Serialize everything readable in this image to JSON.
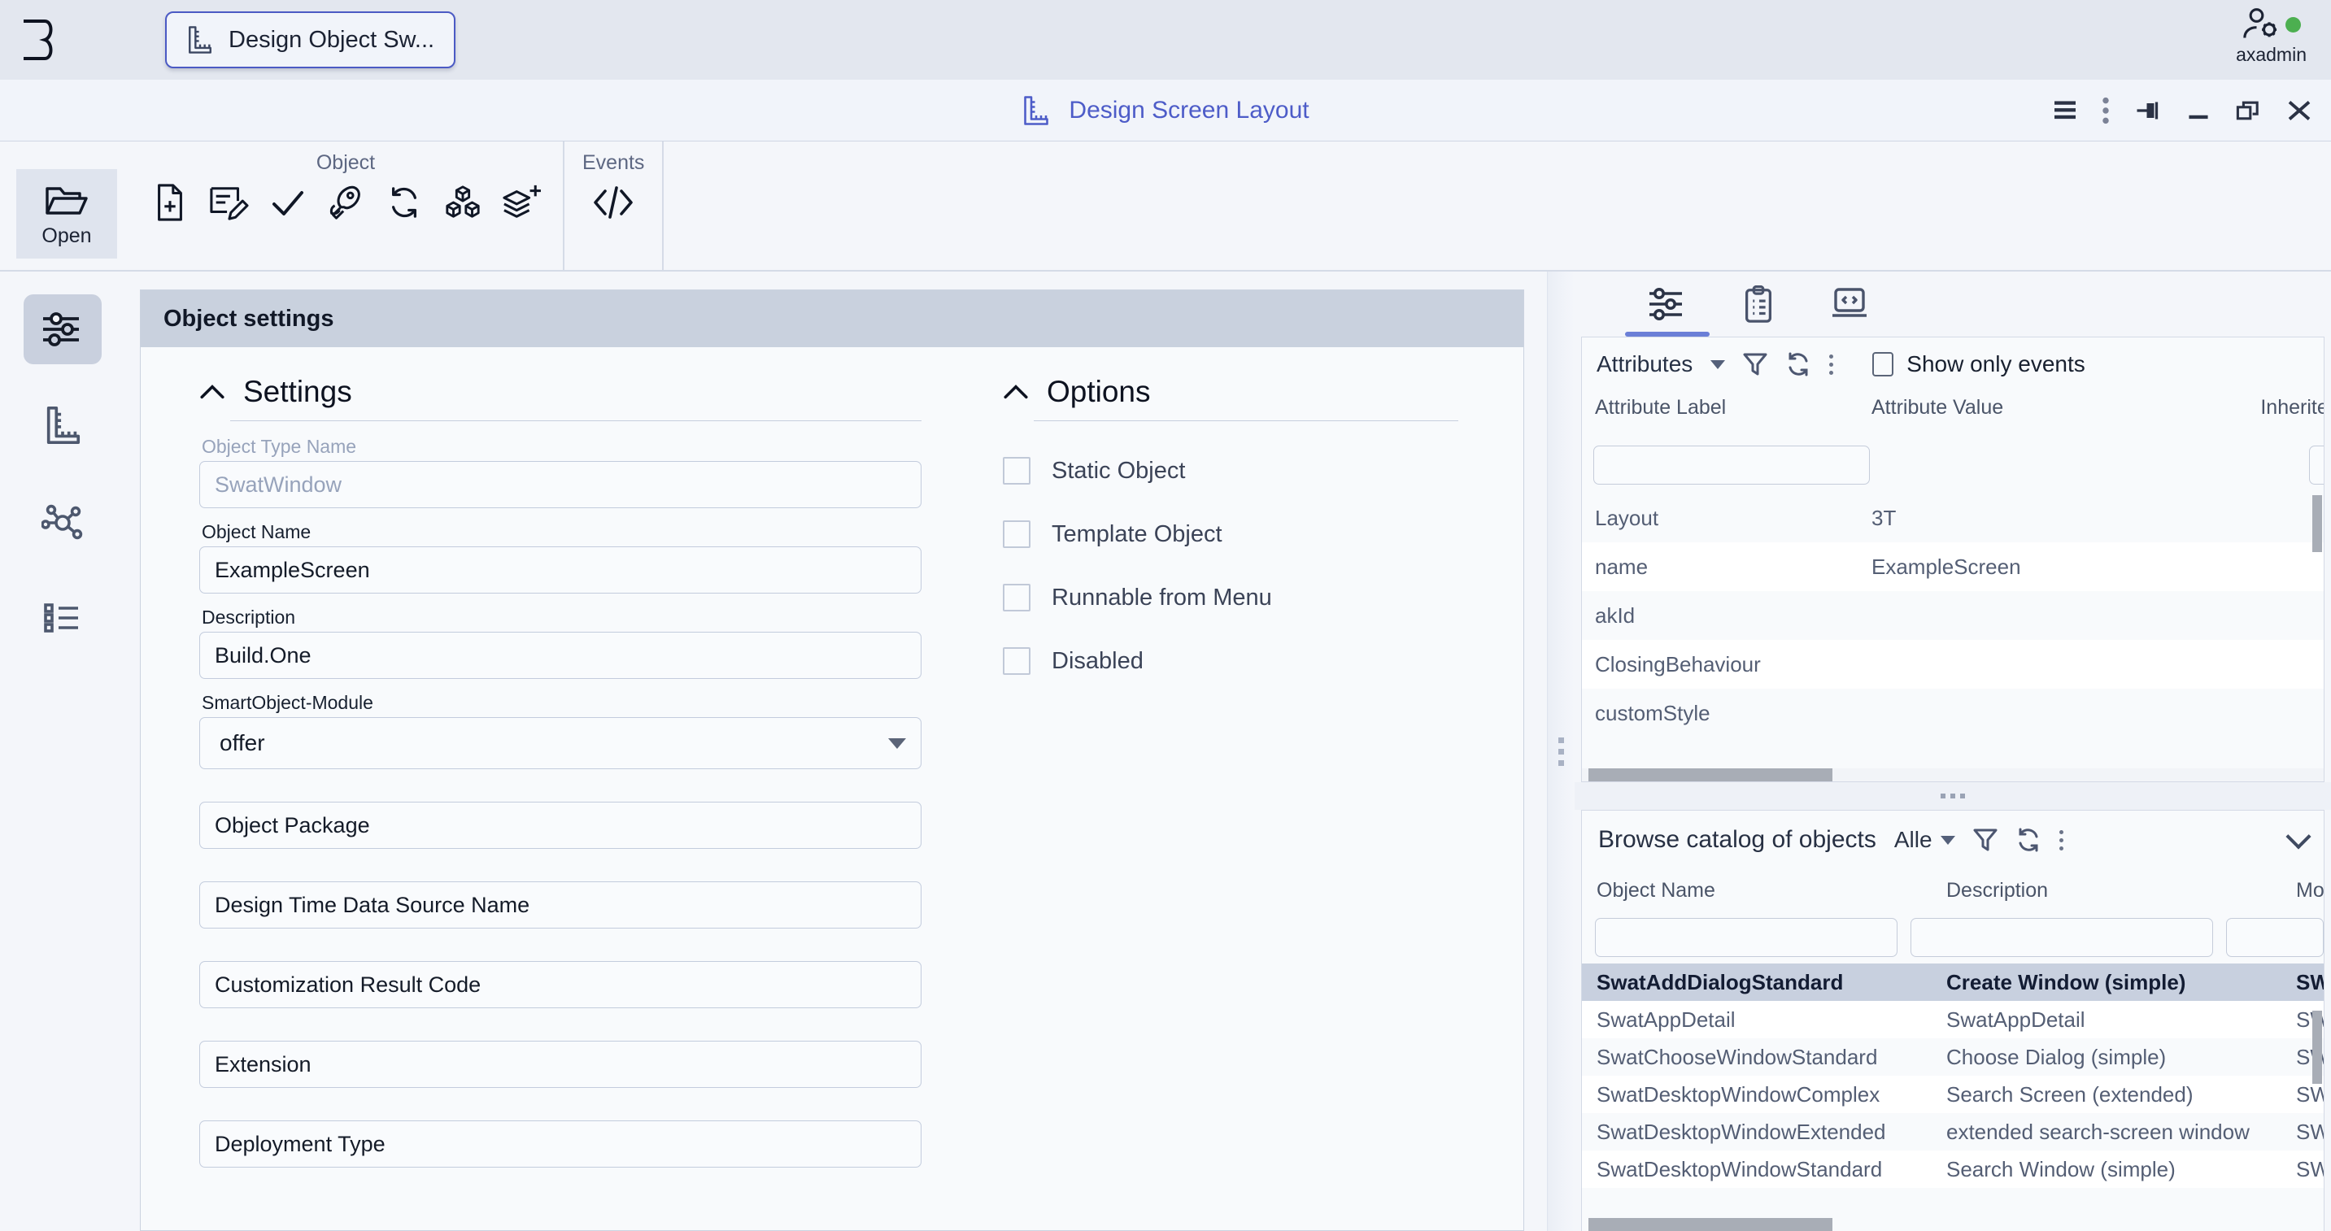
{
  "appbar": {
    "logo_icon": "logo-b-mark",
    "tab": {
      "icon": "ruler-icon",
      "label": "Design Object Sw..."
    },
    "user": {
      "icon": "user-gear-icon",
      "name": "axadmin",
      "status_color": "#4caf50"
    }
  },
  "window": {
    "icon": "ruler-icon",
    "title": "Design Screen Layout",
    "controls": [
      {
        "name": "menu-icon"
      },
      {
        "name": "kebab-menu-icon"
      },
      {
        "name": "pin-icon"
      },
      {
        "name": "minimize-icon"
      },
      {
        "name": "restore-icon"
      },
      {
        "name": "close-icon"
      }
    ]
  },
  "ribbon": {
    "open_button": {
      "icon": "folder-open-icon",
      "label": "Open"
    },
    "groups": [
      {
        "title": "Object",
        "icons": [
          "new-file-icon",
          "edit-document-icon",
          "check-icon",
          "rocket-icon",
          "refresh-icon",
          "cubes-icon",
          "layers-add-icon"
        ]
      },
      {
        "title": "Events",
        "icons": [
          "code-icon"
        ]
      }
    ]
  },
  "rail": {
    "items": [
      {
        "name": "sliders-icon",
        "active": true
      },
      {
        "name": "ruler-icon",
        "active": false
      },
      {
        "name": "network-icon",
        "active": false
      },
      {
        "name": "list-icon",
        "active": false
      }
    ]
  },
  "main": {
    "card_title": "Object settings",
    "settings": {
      "title": "Settings",
      "collapse_icon": "chevron-up-icon",
      "fields": [
        {
          "label": "Object Type Name",
          "value": "SwatWindow",
          "muted": true,
          "type": "text"
        },
        {
          "label": "Object Name",
          "value": "ExampleScreen",
          "muted": false,
          "type": "text"
        },
        {
          "label": "Description",
          "value": "Build.One",
          "muted": false,
          "type": "text"
        },
        {
          "label": "SmartObject-Module",
          "value": "offer",
          "muted": false,
          "type": "select"
        }
      ],
      "placeholder_fields": [
        "Object Package",
        "Design Time Data Source Name",
        "Customization Result Code",
        "Extension",
        "Deployment Type"
      ]
    },
    "options": {
      "title": "Options",
      "collapse_icon": "chevron-up-icon",
      "checkboxes": [
        {
          "label": "Static Object",
          "checked": false
        },
        {
          "label": "Template Object",
          "checked": false
        },
        {
          "label": "Runnable from Menu",
          "checked": false
        },
        {
          "label": "Disabled",
          "checked": false
        }
      ]
    }
  },
  "rightpane": {
    "tabs": [
      {
        "name": "sliders-icon",
        "active": true
      },
      {
        "name": "clipboard-list-icon",
        "active": false
      },
      {
        "name": "code-screen-icon",
        "active": false
      }
    ],
    "attributes": {
      "toolbar": {
        "label": "Attributes",
        "dropdown_icon": "caret-down-icon",
        "filter_icon": "filter-icon",
        "refresh_icon": "refresh-icon",
        "kebab_icon": "kebab-menu-icon",
        "checkbox_label": "Show only events",
        "checkbox_checked": false
      },
      "columns": [
        "Attribute Label",
        "Attribute Value",
        "Inherited"
      ],
      "rows": [
        {
          "label": "Layout",
          "value": "3T",
          "inherited": ""
        },
        {
          "label": "name",
          "value": "ExampleScreen",
          "inherited": ""
        },
        {
          "label": "akId",
          "value": "",
          "inherited": ""
        },
        {
          "label": "ClosingBehaviour",
          "value": "",
          "inherited": ""
        },
        {
          "label": "customStyle",
          "value": "",
          "inherited": ""
        }
      ]
    },
    "catalog": {
      "title": "Browse catalog of objects",
      "select_value": "Alle",
      "filter_icon": "filter-icon",
      "refresh_icon": "refresh-icon",
      "kebab_icon": "kebab-menu-icon",
      "collapse_icon": "chevron-down-icon",
      "columns": [
        "Object Name",
        "Description",
        "Module"
      ],
      "rows": [
        {
          "name": "SwatAddDialogStandard",
          "description": "Create Window (simple)",
          "module": "SWAT",
          "selected": true
        },
        {
          "name": "SwatAppDetail",
          "description": "SwatAppDetail",
          "module": "SWAT",
          "selected": false
        },
        {
          "name": "SwatChooseWindowStandard",
          "description": "Choose Dialog (simple)",
          "module": "SWAT",
          "selected": false
        },
        {
          "name": "SwatDesktopWindowComplex",
          "description": "Search Screen (extended)",
          "module": "SWAT",
          "selected": false
        },
        {
          "name": "SwatDesktopWindowExtended",
          "description": "extended search-screen window",
          "module": "SWAT",
          "selected": false
        },
        {
          "name": "SwatDesktopWindowStandard",
          "description": "Search Window (simple)",
          "module": "SWAT",
          "selected": false
        }
      ]
    }
  },
  "theme": {
    "accent": "#4d5cc8",
    "appbar_bg": "#e3e7ef",
    "panel_bg": "#f8fafc",
    "selection_bg": "#c8d0df",
    "status_green": "#4caf50"
  }
}
